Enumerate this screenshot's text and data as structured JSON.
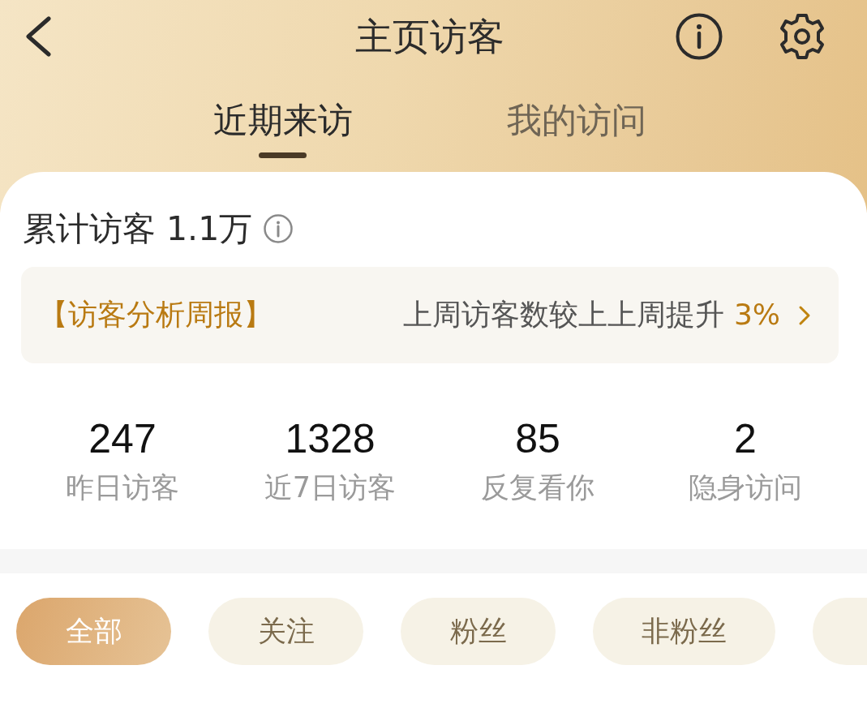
{
  "header": {
    "title": "主页访客"
  },
  "tabs": [
    {
      "label": "近期来访",
      "selected": true
    },
    {
      "label": "我的访问",
      "selected": false
    }
  ],
  "summary": {
    "title": "累计访客 1.1万"
  },
  "weekly_report": {
    "title": "【访客分析周报】",
    "text": "上周访客数较上上周提升",
    "change": "3%"
  },
  "stats": [
    {
      "value": "247",
      "label": "昨日访客"
    },
    {
      "value": "1328",
      "label": "近7日访客"
    },
    {
      "value": "85",
      "label": "反复看你"
    },
    {
      "value": "2",
      "label": "隐身访问"
    }
  ],
  "filters": [
    {
      "label": "全部",
      "selected": true
    },
    {
      "label": "关注",
      "selected": false
    },
    {
      "label": "粉丝",
      "selected": false
    },
    {
      "label": "非粉丝",
      "selected": false
    },
    {
      "selected": false
    }
  ]
}
